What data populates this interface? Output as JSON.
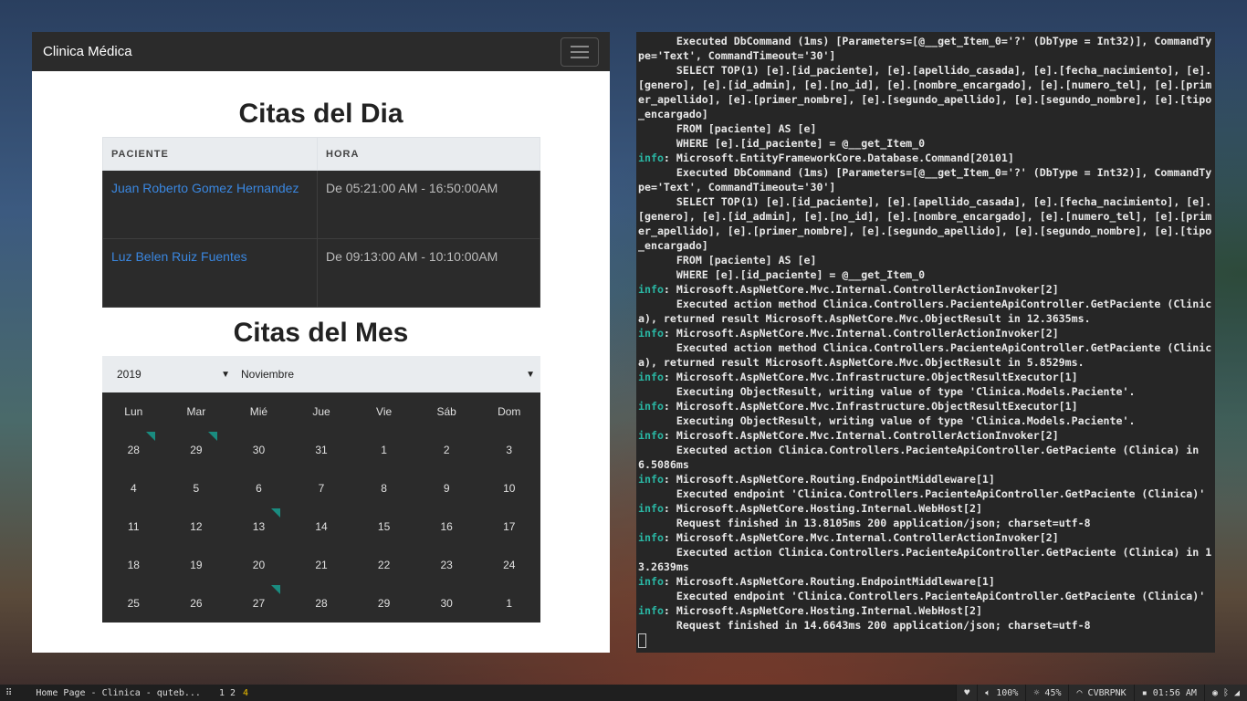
{
  "browser": {
    "brand": "Clinica Médica",
    "citas_dia": {
      "title": "Citas del Dia",
      "col_paciente": "PACIENTE",
      "col_hora": "HORA",
      "rows": [
        {
          "paciente": "Juan Roberto Gomez Hernandez",
          "hora": "De 05:21:00 AM - 16:50:00AM"
        },
        {
          "paciente": "Luz Belen Ruiz Fuentes",
          "hora": "De 09:13:00 AM - 10:10:00AM"
        }
      ]
    },
    "citas_mes": {
      "title": "Citas del Mes",
      "year": "2019",
      "month": "Noviembre",
      "weekdays": [
        "Lun",
        "Mar",
        "Mié",
        "Jue",
        "Vie",
        "Sáb",
        "Dom"
      ],
      "weeks": [
        [
          "28",
          "29",
          "30",
          "31",
          "1",
          "2",
          "3"
        ],
        [
          "4",
          "5",
          "6",
          "7",
          "8",
          "9",
          "10"
        ],
        [
          "11",
          "12",
          "13",
          "14",
          "15",
          "16",
          "17"
        ],
        [
          "18",
          "19",
          "20",
          "21",
          "22",
          "23",
          "24"
        ],
        [
          "25",
          "26",
          "27",
          "28",
          "29",
          "30",
          "1"
        ]
      ],
      "marker_color": "#1a8c80"
    }
  },
  "terminal": {
    "lines": [
      {
        "t": "      Executed DbCommand (1ms) [Parameters=[@__get_Item_0='?' (DbType = Int32)], CommandType='Text', CommandTimeout='30']"
      },
      {
        "t": "      SELECT TOP(1) [e].[id_paciente], [e].[apellido_casada], [e].[fecha_nacimiento], [e].[genero], [e].[id_admin], [e].[no_id], [e].[nombre_encargado], [e].[numero_tel], [e].[primer_apellido], [e].[primer_nombre], [e].[segundo_apellido], [e].[segundo_nombre], [e].[tipo_encargado]"
      },
      {
        "t": "      FROM [paciente] AS [e]"
      },
      {
        "t": "      WHERE [e].[id_paciente] = @__get_Item_0"
      },
      {
        "info": "info",
        "t": ": Microsoft.EntityFrameworkCore.Database.Command[20101]"
      },
      {
        "t": "      Executed DbCommand (1ms) [Parameters=[@__get_Item_0='?' (DbType = Int32)], CommandType='Text', CommandTimeout='30']"
      },
      {
        "t": "      SELECT TOP(1) [e].[id_paciente], [e].[apellido_casada], [e].[fecha_nacimiento], [e].[genero], [e].[id_admin], [e].[no_id], [e].[nombre_encargado], [e].[numero_tel], [e].[primer_apellido], [e].[primer_nombre], [e].[segundo_apellido], [e].[segundo_nombre], [e].[tipo_encargado]"
      },
      {
        "t": "      FROM [paciente] AS [e]"
      },
      {
        "t": "      WHERE [e].[id_paciente] = @__get_Item_0"
      },
      {
        "info": "info",
        "t": ": Microsoft.AspNetCore.Mvc.Internal.ControllerActionInvoker[2]"
      },
      {
        "t": "      Executed action method Clinica.Controllers.PacienteApiController.GetPaciente (Clinica), returned result Microsoft.AspNetCore.Mvc.ObjectResult in 12.3635ms."
      },
      {
        "info": "info",
        "t": ": Microsoft.AspNetCore.Mvc.Internal.ControllerActionInvoker[2]"
      },
      {
        "t": "      Executed action method Clinica.Controllers.PacienteApiController.GetPaciente (Clinica), returned result Microsoft.AspNetCore.Mvc.ObjectResult in 5.8529ms."
      },
      {
        "info": "info",
        "t": ": Microsoft.AspNetCore.Mvc.Infrastructure.ObjectResultExecutor[1]"
      },
      {
        "t": "      Executing ObjectResult, writing value of type 'Clinica.Models.Paciente'."
      },
      {
        "info": "info",
        "t": ": Microsoft.AspNetCore.Mvc.Infrastructure.ObjectResultExecutor[1]"
      },
      {
        "t": "      Executing ObjectResult, writing value of type 'Clinica.Models.Paciente'."
      },
      {
        "info": "info",
        "t": ": Microsoft.AspNetCore.Mvc.Internal.ControllerActionInvoker[2]"
      },
      {
        "t": "      Executed action Clinica.Controllers.PacienteApiController.GetPaciente (Clinica) in 6.5086ms"
      },
      {
        "info": "info",
        "t": ": Microsoft.AspNetCore.Routing.EndpointMiddleware[1]"
      },
      {
        "t": "      Executed endpoint 'Clinica.Controllers.PacienteApiController.GetPaciente (Clinica)'"
      },
      {
        "info": "info",
        "t": ": Microsoft.AspNetCore.Hosting.Internal.WebHost[2]"
      },
      {
        "t": "      Request finished in 13.8105ms 200 application/json; charset=utf-8"
      },
      {
        "info": "info",
        "t": ": Microsoft.AspNetCore.Mvc.Internal.ControllerActionInvoker[2]"
      },
      {
        "t": "      Executed action Clinica.Controllers.PacienteApiController.GetPaciente (Clinica) in 13.2639ms"
      },
      {
        "info": "info",
        "t": ": Microsoft.AspNetCore.Routing.EndpointMiddleware[1]"
      },
      {
        "t": "      Executed endpoint 'Clinica.Controllers.PacienteApiController.GetPaciente (Clinica)'"
      },
      {
        "info": "info",
        "t": ": Microsoft.AspNetCore.Hosting.Internal.WebHost[2]"
      },
      {
        "t": "      Request finished in 14.6643ms 200 application/json; charset=utf-8"
      }
    ]
  },
  "taskbar": {
    "window_title": "Home Page - Clinica - quteb...",
    "workspaces": [
      "1",
      "2",
      "4"
    ],
    "active_workspace": "4",
    "volume": "100%",
    "brightness": "45%",
    "wifi": "CVBRPNK",
    "time": "01:56 AM"
  }
}
